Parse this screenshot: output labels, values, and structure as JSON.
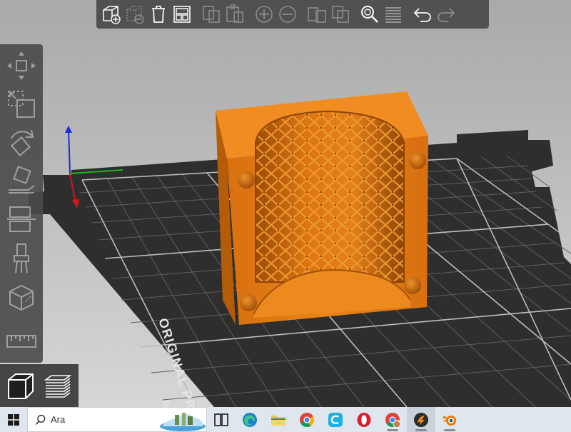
{
  "bed": {
    "label": "ORIGINAL PRUSA",
    "label_tail": "b"
  },
  "taskbar": {
    "search_placeholder": "Ara"
  },
  "colors": {
    "model": "#e37b14",
    "bed": "#2f2f2f",
    "toolbar": "#4a4a4a",
    "grid": "#8a8a8a"
  },
  "top_toolbar": [
    "add-icon",
    "delete-icon",
    "delete-all-icon",
    "arrange-icon",
    "copy-icon",
    "paste-icon",
    "add-instance-icon",
    "remove-instance-icon",
    "split-objects-icon",
    "split-parts-icon",
    "search-icon",
    "layers-editing-icon",
    "undo-icon",
    "redo-icon"
  ],
  "left_toolbar": [
    "move-icon",
    "scale-icon",
    "rotate-icon",
    "place-on-face-icon",
    "cut-icon",
    "paint-supports-icon",
    "seam-painting-icon",
    "measure-icon"
  ],
  "view_tabs": [
    "3d-view-icon",
    "preview-icon"
  ],
  "taskbar_apps": [
    "task-view-icon",
    "edge-icon",
    "file-explorer-icon",
    "chrome-icon",
    "ccleaner-icon",
    "opera-icon",
    "chrome-profile-icon",
    "prusaslicer-icon",
    "blender-icon"
  ]
}
